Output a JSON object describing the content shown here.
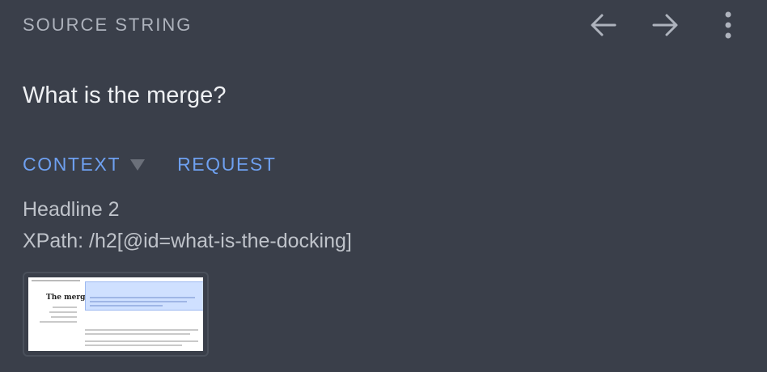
{
  "header": {
    "section_label": "SOURCE STRING",
    "back_icon": "arrow-left-icon",
    "forward_icon": "arrow-right-icon",
    "menu_icon": "more-vertical-icon"
  },
  "source": {
    "text": "What is the merge?"
  },
  "tabs": {
    "context_label": "CONTEXT",
    "request_label": "REQUEST"
  },
  "context": {
    "element_type": "Headline 2",
    "xpath": "XPath: /h2[@id=what-is-the-docking]"
  },
  "screenshot": {
    "page_title": "The merge"
  },
  "colors": {
    "background": "#3a3f4a",
    "accent": "#6ea0f0",
    "muted": "#aeb3bd"
  }
}
